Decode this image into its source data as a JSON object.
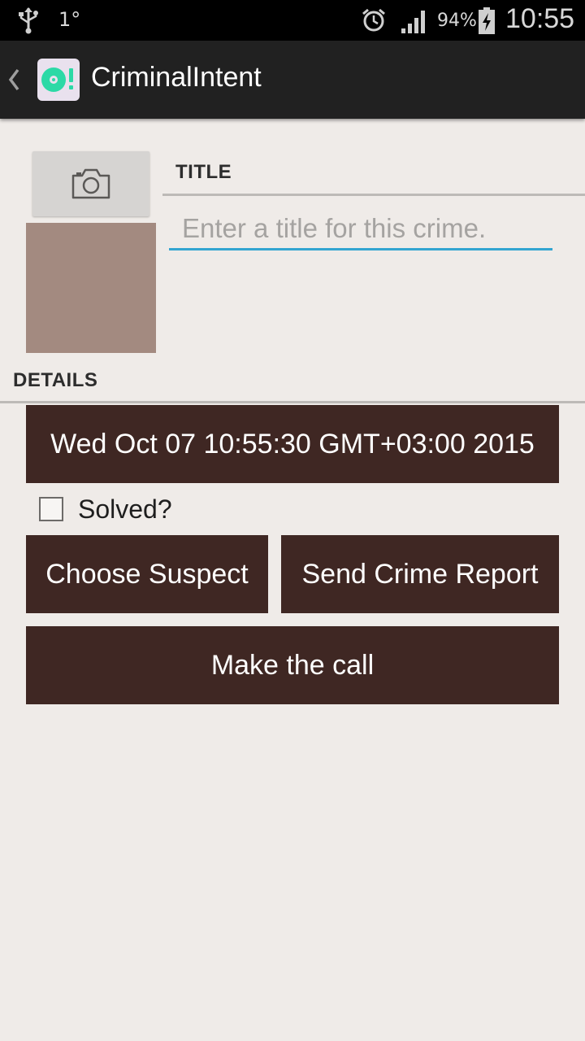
{
  "status_bar": {
    "temperature": "1°",
    "battery_percent": "94%",
    "time": "10:55",
    "icons": [
      "usb-icon",
      "alarm-icon",
      "signal-icon",
      "battery-charging-icon"
    ]
  },
  "action_bar": {
    "title": "CriminalIntent",
    "icons": [
      "up-caret-icon",
      "app-icon"
    ]
  },
  "crime": {
    "title_header": "TITLE",
    "title_placeholder": "Enter a title for this crime.",
    "title_value": "",
    "details_header": "DETAILS",
    "date_label": "Wed Oct 07 10:55:30 GMT+03:00 2015",
    "solved_label": "Solved?",
    "solved_checked": false,
    "suspect_label": "Choose Suspect",
    "report_label": "Send Crime Report",
    "call_label": "Make the call"
  },
  "colors": {
    "button_brown": "#3f2723",
    "photo_placeholder": "#a38a80",
    "field_underline": "#33a5d1",
    "background": "#efebe8"
  }
}
